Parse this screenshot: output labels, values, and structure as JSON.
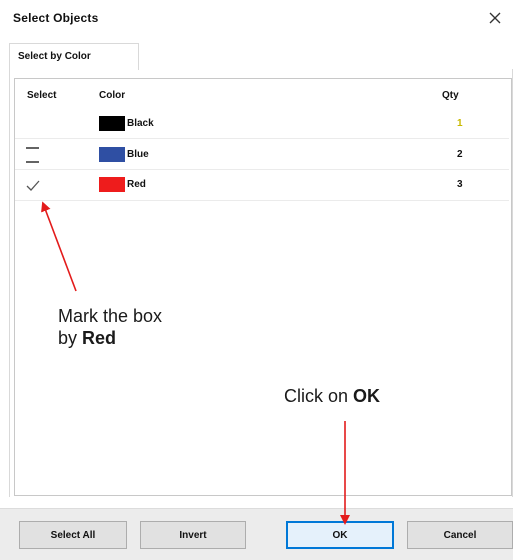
{
  "window": {
    "title": "Select Objects"
  },
  "tabs": [
    {
      "label": "Select by Color",
      "active": true
    }
  ],
  "table": {
    "headers": {
      "select": "Select",
      "color": "Color",
      "qty": "Qty"
    },
    "rows": [
      {
        "select_state": "none",
        "color_name": "Black",
        "swatch": "#000000",
        "qty": "1"
      },
      {
        "select_state": "dash",
        "color_name": "Blue",
        "swatch": "#2f4fa3",
        "qty": "2"
      },
      {
        "select_state": "check",
        "color_name": "Red",
        "swatch": "#ee1c1c",
        "qty": "3"
      }
    ]
  },
  "buttons": {
    "select_all": "Select All",
    "invert": "Invert",
    "ok": "OK",
    "cancel": "Cancel"
  },
  "annotations": {
    "mark_line1": "Mark the box",
    "mark_by": "by ",
    "mark_bold": "Red",
    "click_pre": "Click on ",
    "click_bold": "OK"
  },
  "colors": {
    "annotation_arrow": "#e31b1b",
    "primary_button_border": "#0078d7"
  }
}
